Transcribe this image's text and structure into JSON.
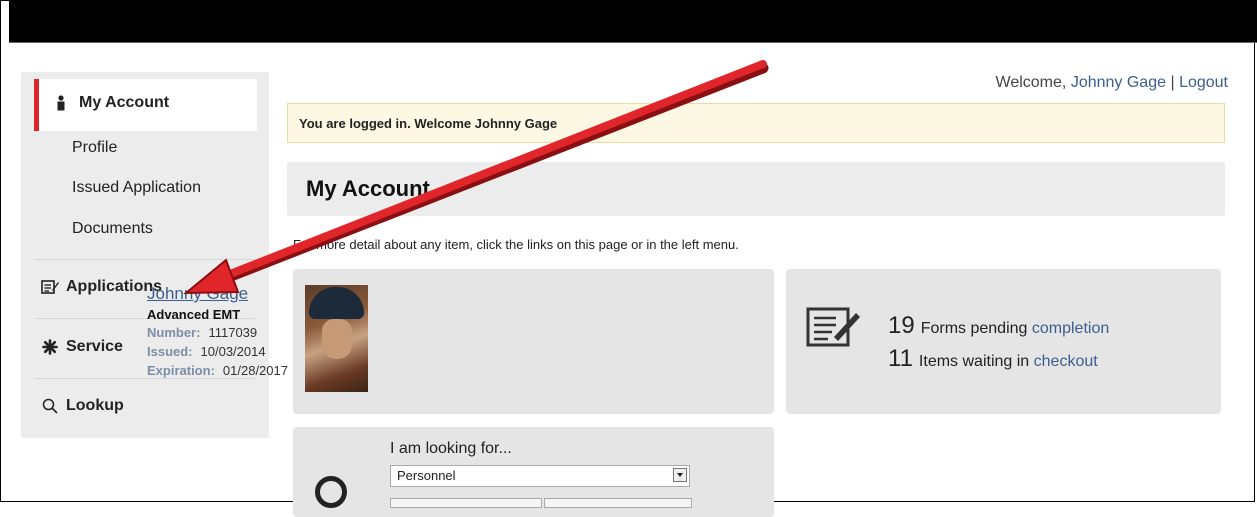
{
  "header": {
    "welcome_prefix": "Welcome,",
    "user_name": "Johnny Gage",
    "separator": "|",
    "logout": "Logout"
  },
  "sidebar": {
    "my_account": "My Account",
    "profile": "Profile",
    "issued_application": "Issued Application",
    "documents": "Documents",
    "applications": "Applications",
    "service": "Service",
    "lookup": "Lookup"
  },
  "alert": "You are logged in. Welcome Johnny Gage",
  "page_title": "My Account",
  "info": "For more detail about any item, click the links on this page or in the left menu.",
  "profile_card": {
    "name": "Johnny Gage",
    "certification": "Advanced EMT",
    "number_label": "Number:",
    "number": "1117039",
    "issued_label": "Issued:",
    "issued": "10/03/2014",
    "expiration_label": "Expiration:",
    "expiration": "01/28/2017"
  },
  "stats": {
    "forms_count": "19",
    "forms_text": "Forms pending",
    "forms_link": "completion",
    "items_count": "11",
    "items_text": "Items waiting in",
    "items_link": "checkout"
  },
  "lookup": {
    "title": "I am looking for...",
    "selected": "Personnel"
  },
  "colors": {
    "accent_red": "#d9262b",
    "link_blue": "#3a5f8f",
    "alert_bg": "#fcf8e3"
  }
}
